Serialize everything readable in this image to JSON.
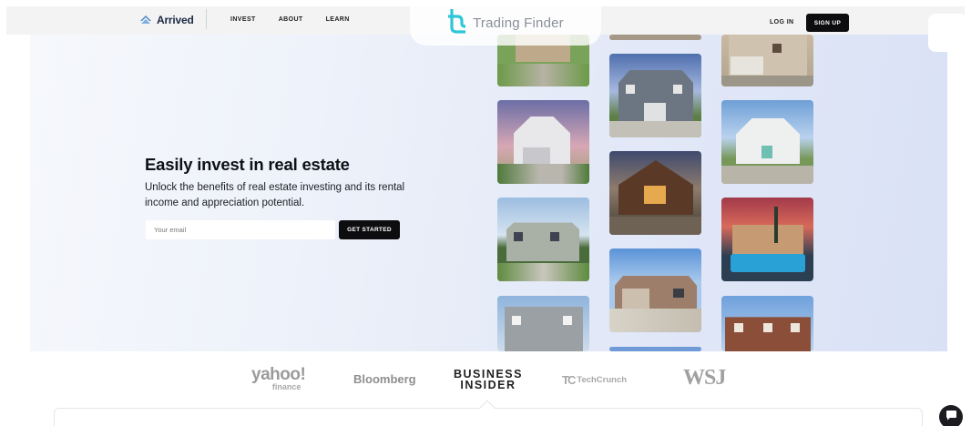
{
  "header": {
    "brand": "Arrived",
    "nav": [
      {
        "label": "INVEST"
      },
      {
        "label": "ABOUT"
      },
      {
        "label": "LEARN"
      }
    ],
    "login_label": "LOG IN",
    "signup_label": "SIGN UP"
  },
  "watermark": {
    "text": "Trading Finder"
  },
  "hero": {
    "title": "Easily invest in real estate",
    "subtitle": "Unlock the benefits of real estate investing and its rental income and appreciation potential.",
    "email_placeholder": "Your email",
    "email_value": "",
    "cta_label": "GET STARTED"
  },
  "press": {
    "yahoo_main": "yahoo!",
    "yahoo_sub": "finance",
    "bloomberg": "Bloomberg",
    "business_insider_line1": "BUSINESS",
    "business_insider_line2": "INSIDER",
    "techcrunch_mark": "TC",
    "techcrunch": "TechCrunch",
    "wsj": "WSJ"
  },
  "colors": {
    "accent_dark": "#0d0d0f",
    "brand_blue": "#4a86c8",
    "watermark_teal": "#2fc7d8",
    "hero_bg": "#e3e9f7"
  },
  "icons": {
    "brand": "house-stack-icon",
    "watermark": "trading-finder-logo-icon",
    "chat": "chat-bubble-icon"
  }
}
